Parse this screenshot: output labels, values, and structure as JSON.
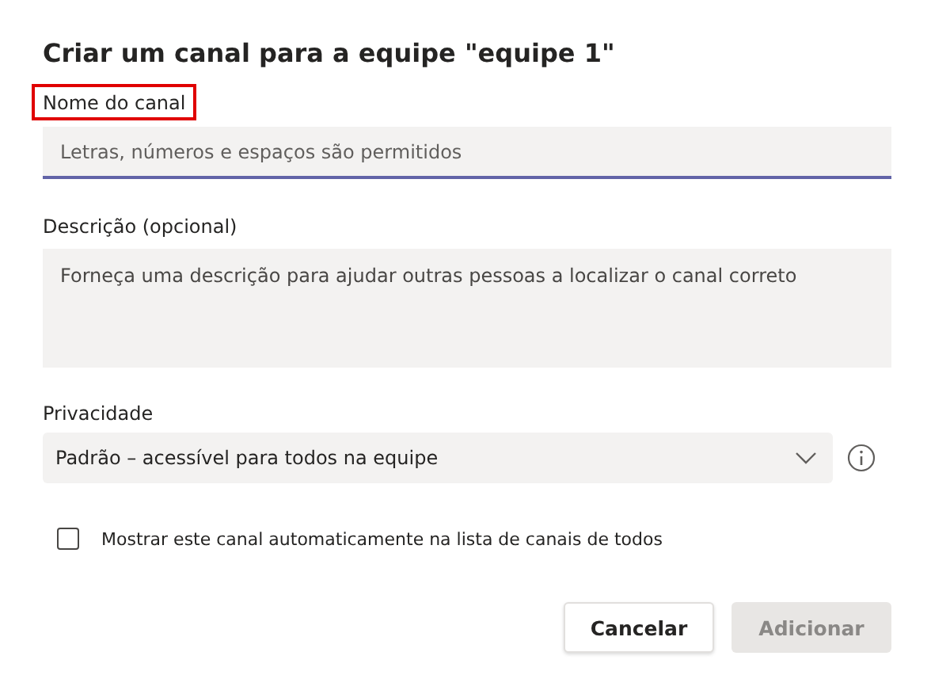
{
  "dialog": {
    "title": "Criar um canal para a equipe \"equipe 1\""
  },
  "name_field": {
    "label": "Nome do canal",
    "highlighted": true,
    "placeholder": "Letras, números e espaços são permitidos",
    "focused": true
  },
  "description_field": {
    "label": "Descrição (opcional)",
    "placeholder": "Forneça uma descrição para ajudar outras pessoas a localizar o canal correto"
  },
  "privacy": {
    "label": "Privacidade",
    "value": "Padrão – acessível para todos na equipe"
  },
  "auto_show": {
    "label": "Mostrar este canal automaticamente na lista de canais de todos",
    "checked": false
  },
  "buttons": [
    {
      "label": "Cancelar",
      "kind": "secondary",
      "disabled": false
    },
    {
      "label": "Adicionar",
      "kind": "primary",
      "disabled": true
    }
  ]
}
